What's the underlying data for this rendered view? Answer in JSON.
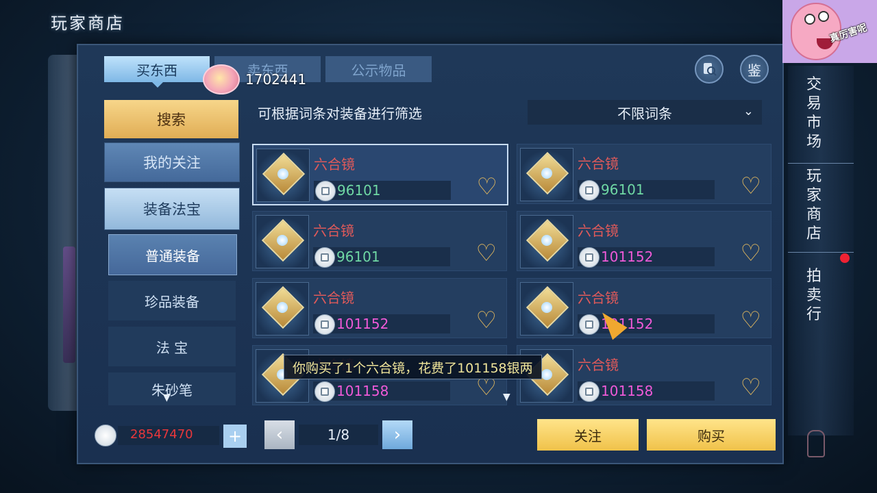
{
  "page_title": "玩家商店",
  "tabs": [
    {
      "label": "买东西",
      "active": true
    },
    {
      "label": "卖东西",
      "active": false
    },
    {
      "label": "公示物品",
      "active": false
    }
  ],
  "player_id": "1702441",
  "top_buttons": {
    "inspect_icon": "magnifier-scroll-icon",
    "appraise_label": "鉴"
  },
  "left_menu": {
    "search": "搜索",
    "my_follow": "我的关注",
    "equip_fabao": "装备法宝",
    "sub_items": [
      "普通装备",
      "珍品装备",
      "法 宝",
      "朱砂笔"
    ]
  },
  "filter": {
    "label": "可根据词条对装备进行筛选",
    "select_value": "不限词条"
  },
  "items": [
    {
      "name": "六合镜",
      "price": "96101",
      "price_color": "green",
      "selected": true
    },
    {
      "name": "六合镜",
      "price": "96101",
      "price_color": "green",
      "selected": false
    },
    {
      "name": "六合镜",
      "price": "96101",
      "price_color": "green",
      "selected": false
    },
    {
      "name": "六合镜",
      "price": "101152",
      "price_color": "pink",
      "selected": false
    },
    {
      "name": "六合镜",
      "price": "101152",
      "price_color": "pink",
      "selected": false
    },
    {
      "name": "六合镜",
      "price": "101152",
      "price_color": "pink",
      "selected": false
    },
    {
      "name": "六合镜",
      "price": "101158",
      "price_color": "pink",
      "selected": false
    },
    {
      "name": "六合镜",
      "price": "101158",
      "price_color": "pink",
      "selected": false
    }
  ],
  "toast": "你购买了1个六合镜，花费了101158银两",
  "money": "28547470",
  "add_label": "+",
  "pagination": {
    "current": "1/8"
  },
  "bottom_buttons": {
    "follow": "关注",
    "buy": "购买"
  },
  "right_nav": {
    "market": "交易市场",
    "shop": "玩家商店",
    "auction": "拍卖行"
  },
  "watermark_text": "真厉害呢",
  "colors": {
    "price_green": "#6fd8a4",
    "price_pink": "#f05ad8",
    "item_name_red": "#e05a5a",
    "money_red": "#e8373b",
    "gold_button": "#f0c24a"
  }
}
